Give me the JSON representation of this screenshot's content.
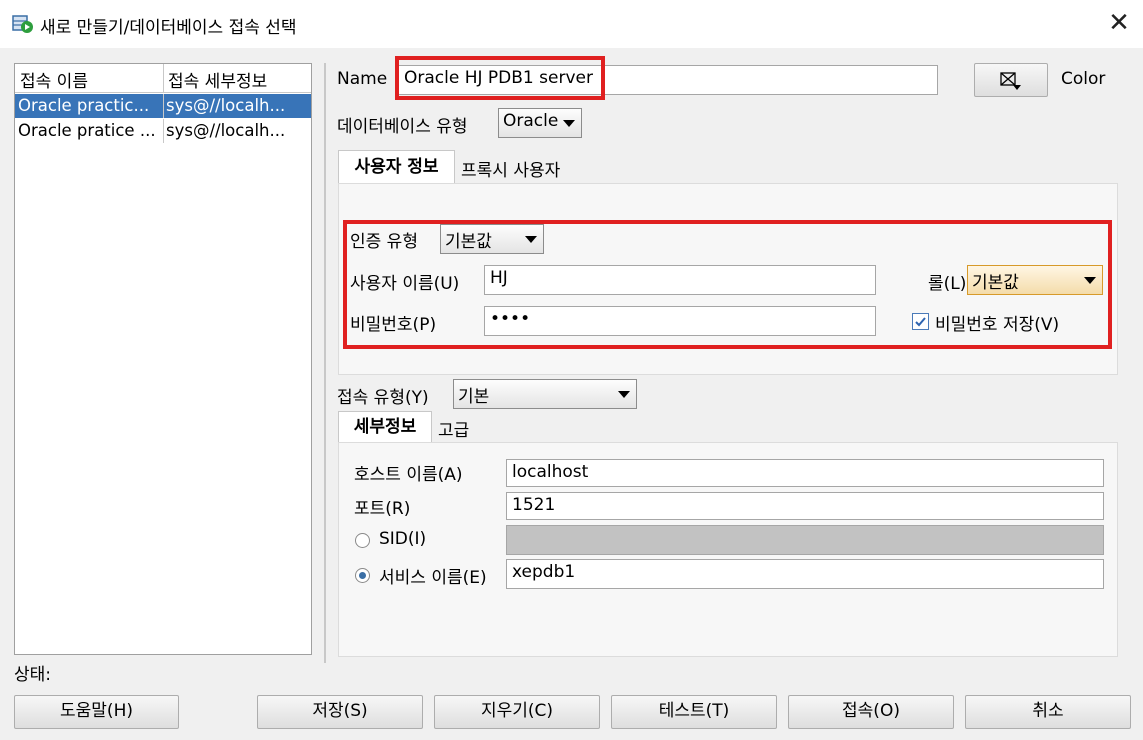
{
  "window": {
    "title": "새로 만들기/데이터베이스 접속 선택",
    "close_glyph": "✕"
  },
  "connections": {
    "headers": [
      "접속 이름",
      "접속 세부정보"
    ],
    "rows": [
      {
        "name": "Oracle practic...",
        "detail": "sys@//localh...",
        "selected": true
      },
      {
        "name": "Oracle pratice ...",
        "detail": "sys@//localh...",
        "selected": false
      }
    ]
  },
  "form": {
    "name_label": "Name",
    "name_value": "Oracle HJ PDB1 server",
    "color_label": "Color",
    "db_type_label": "데이터베이스 유형",
    "db_type_value": "Oracle",
    "tabs": [
      "사용자 정보",
      "프록시 사용자"
    ],
    "auth_type_label": "인증 유형",
    "auth_type_value": "기본값",
    "username_label": "사용자 이름(U)",
    "username_value": "HJ",
    "role_label": "롤(L)",
    "role_value": "기본값",
    "password_label": "비밀번호(P)",
    "password_value": "••••",
    "save_password_label": "비밀번호 저장(V)",
    "save_password_checked": true,
    "conn_type_label": "접속 유형(Y)",
    "conn_type_value": "기본",
    "detail_tabs": [
      "세부정보",
      "고급"
    ],
    "host_label": "호스트 이름(A)",
    "host_value": "localhost",
    "port_label": "포트(R)",
    "port_value": "1521",
    "sid_label": "SID(I)",
    "service_label": "서비스 이름(E)",
    "service_value": "xepdb1"
  },
  "status_label": "상태:",
  "buttons": {
    "help": "도움말(H)",
    "save": "저장(S)",
    "clear": "지우기(C)",
    "test": "테스트(T)",
    "connect": "접속(O)",
    "cancel": "취소"
  }
}
